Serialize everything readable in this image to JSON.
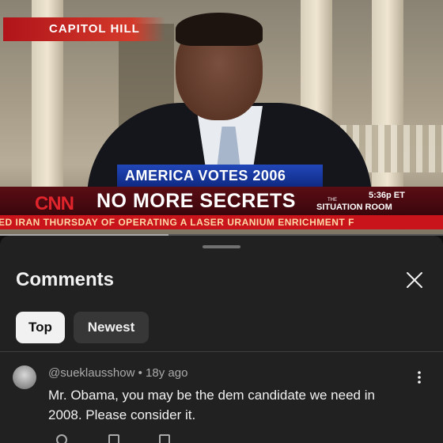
{
  "video": {
    "location_tag": "CAPITOL HILL",
    "banner": "AMERICA VOTES 2006",
    "network_logo": "CNN",
    "headline": "NO MORE SECRETS",
    "program_prefix": "THE",
    "program": "SITUATION ROOM",
    "time": "5:36p ET",
    "ticker": "ED IRAN THURSDAY OF OPERATING A LASER URANIUM ENRICHMENT F",
    "progress": 0.38
  },
  "comments_panel": {
    "title": "Comments",
    "close_icon": "close-icon",
    "filters": [
      {
        "label": "Top",
        "selected": true
      },
      {
        "label": "Newest",
        "selected": false
      }
    ],
    "comments": [
      {
        "author": "@sueklausshow",
        "age": "18y ago",
        "text": "Mr. Obama, you may be the dem candidate we need in 2008. Please consider it."
      }
    ]
  },
  "colors": {
    "background": "#0f0f0f",
    "sheet": "#212121",
    "chip_selected": "#f1f1f1",
    "chip_unselected": "#373737",
    "secondary_text": "#aaaaaa"
  }
}
